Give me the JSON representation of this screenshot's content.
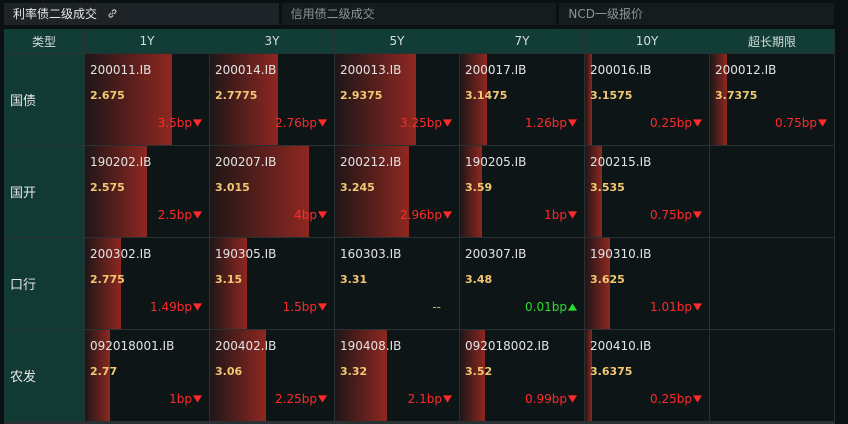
{
  "tabs": [
    {
      "label": "利率债二级成交",
      "active": true,
      "icon": "link-icon"
    },
    {
      "label": "信用债二级成交",
      "active": false
    },
    {
      "label": "NCD一级报价",
      "active": false
    }
  ],
  "header": {
    "corner": "类型",
    "tenors": [
      "1Y",
      "3Y",
      "5Y",
      "7Y",
      "10Y",
      "超长期限"
    ]
  },
  "colors": {
    "down": "#ff2a2a",
    "up": "#2edd2e",
    "price": "#f2c872",
    "header_bg": "#123c36"
  },
  "rows": [
    {
      "label": "国债",
      "cells": [
        {
          "code": "200011.IB",
          "price": "2.675",
          "change": "3.5bp",
          "dir": "down",
          "level": 0.7
        },
        {
          "code": "200014.IB",
          "price": "2.7775",
          "change": "2.76bp",
          "dir": "down",
          "level": 0.55
        },
        {
          "code": "200013.IB",
          "price": "2.9375",
          "change": "3.25bp",
          "dir": "down",
          "level": 0.65
        },
        {
          "code": "200017.IB",
          "price": "3.1475",
          "change": "1.26bp",
          "dir": "down",
          "level": 0.22
        },
        {
          "code": "200016.IB",
          "price": "3.1575",
          "change": "0.25bp",
          "dir": "down",
          "level": 0.06
        },
        {
          "code": "200012.IB",
          "price": "3.7375",
          "change": "0.75bp",
          "dir": "down",
          "level": 0.14
        }
      ]
    },
    {
      "label": "国开",
      "cells": [
        {
          "code": "190202.IB",
          "price": "2.575",
          "change": "2.5bp",
          "dir": "down",
          "level": 0.5
        },
        {
          "code": "200207.IB",
          "price": "3.015",
          "change": "4bp",
          "dir": "down",
          "level": 0.8
        },
        {
          "code": "200212.IB",
          "price": "3.245",
          "change": "2.96bp",
          "dir": "down",
          "level": 0.6
        },
        {
          "code": "190205.IB",
          "price": "3.59",
          "change": "1bp",
          "dir": "down",
          "level": 0.18
        },
        {
          "code": "200215.IB",
          "price": "3.535",
          "change": "0.75bp",
          "dir": "down",
          "level": 0.14
        },
        null
      ]
    },
    {
      "label": "口行",
      "cells": [
        {
          "code": "200302.IB",
          "price": "2.775",
          "change": "1.49bp",
          "dir": "down",
          "level": 0.29
        },
        {
          "code": "190305.IB",
          "price": "3.15",
          "change": "1.5bp",
          "dir": "down",
          "level": 0.3
        },
        {
          "code": "160303.IB",
          "price": "3.31",
          "change": "--",
          "dir": "neutral",
          "level": 0
        },
        {
          "code": "200307.IB",
          "price": "3.48",
          "change": "0.01bp",
          "dir": "up",
          "level": 0
        },
        {
          "code": "190310.IB",
          "price": "3.625",
          "change": "1.01bp",
          "dir": "down",
          "level": 0.2
        },
        null
      ]
    },
    {
      "label": "农发",
      "cells": [
        {
          "code": "092018001.IB",
          "price": "2.77",
          "change": "1bp",
          "dir": "down",
          "level": 0.2
        },
        {
          "code": "200402.IB",
          "price": "3.06",
          "change": "2.25bp",
          "dir": "down",
          "level": 0.45
        },
        {
          "code": "190408.IB",
          "price": "3.32",
          "change": "2.1bp",
          "dir": "down",
          "level": 0.42
        },
        {
          "code": "092018002.IB",
          "price": "3.52",
          "change": "0.99bp",
          "dir": "down",
          "level": 0.2
        },
        {
          "code": "200410.IB",
          "price": "3.6375",
          "change": "0.25bp",
          "dir": "down",
          "level": 0.06
        },
        null
      ]
    }
  ]
}
